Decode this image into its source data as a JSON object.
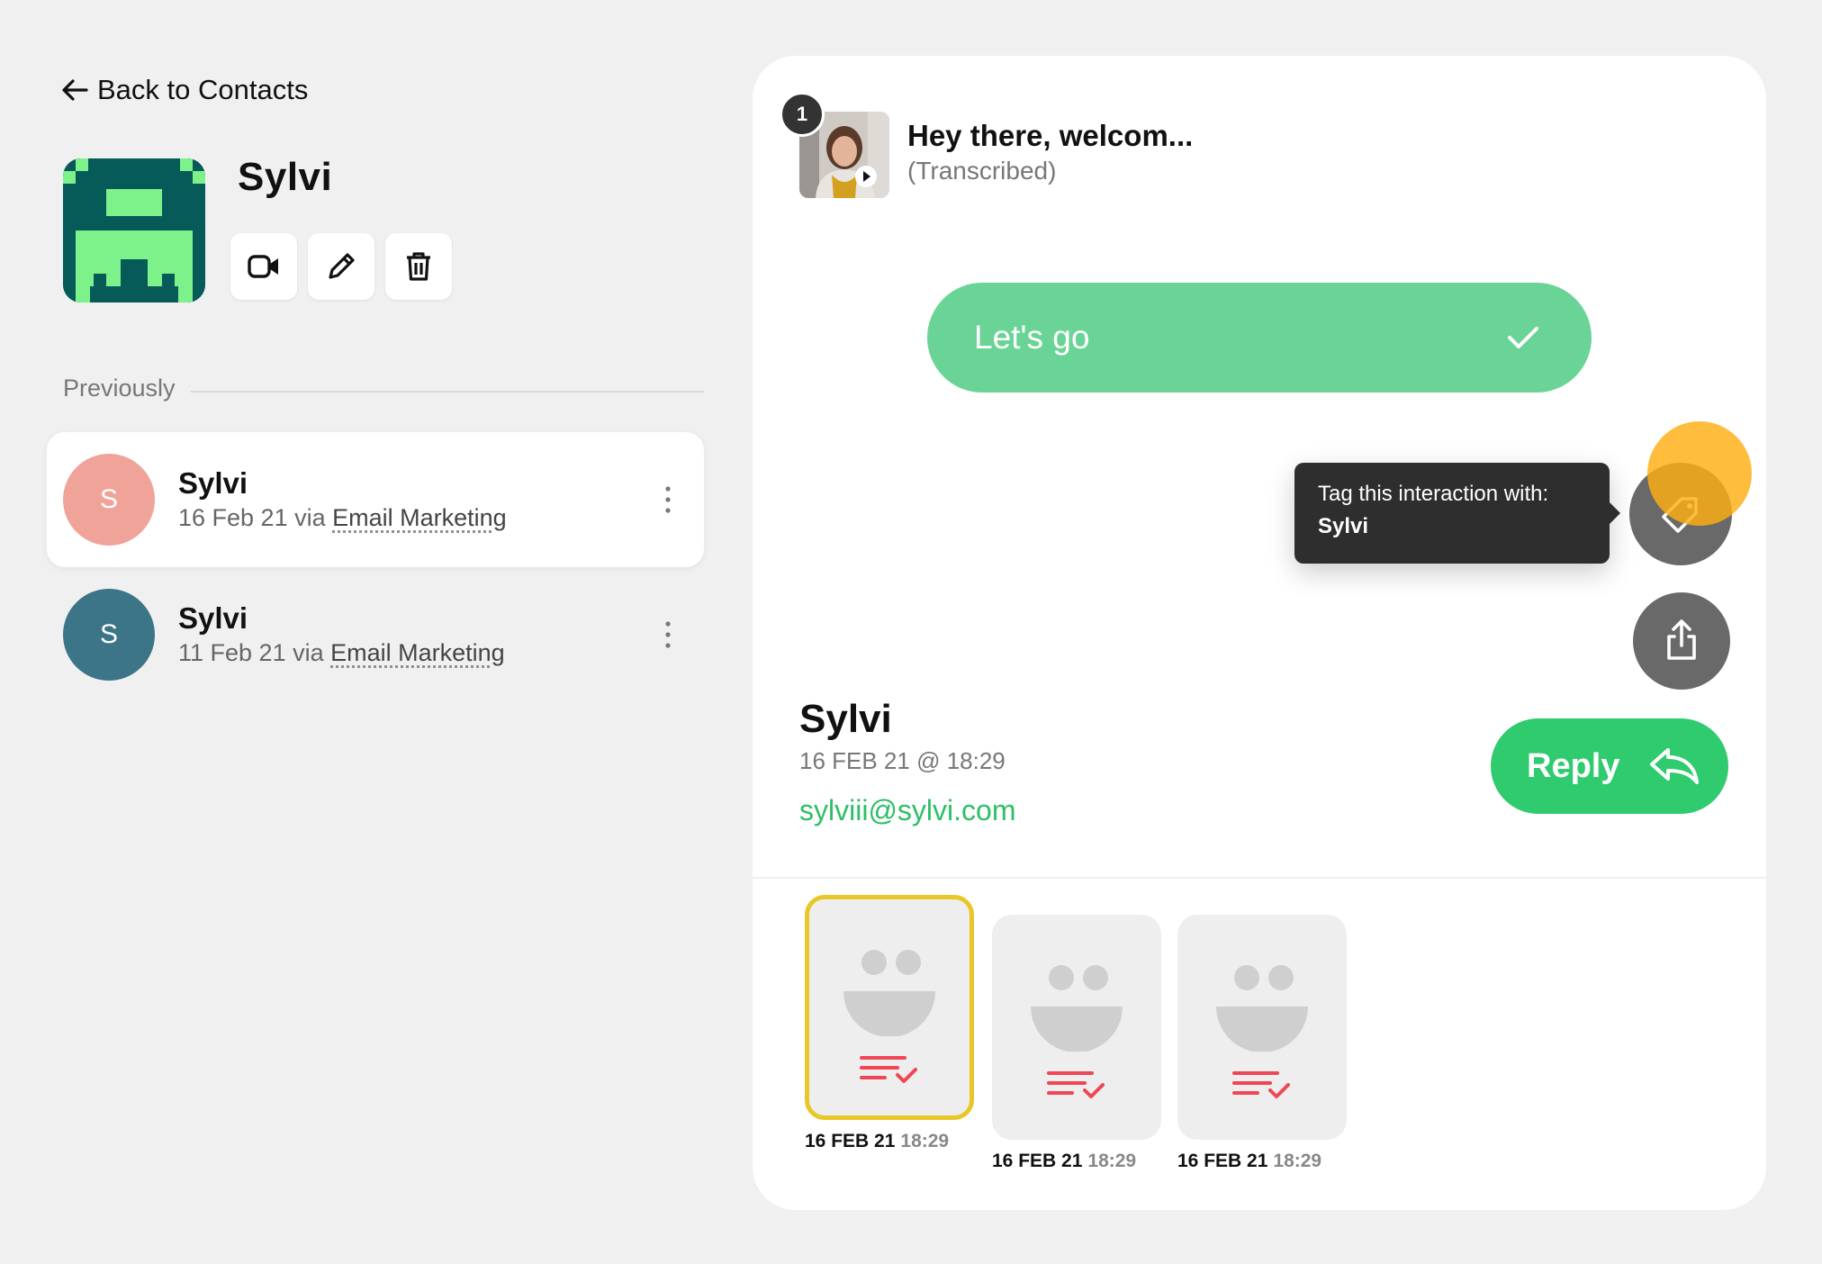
{
  "nav": {
    "back_label": "Back to Contacts"
  },
  "contact": {
    "name": "Sylvi",
    "actions": [
      "video",
      "edit",
      "delete"
    ]
  },
  "previously": {
    "label": "Previously",
    "items": [
      {
        "initial": "S",
        "name": "Sylvi",
        "date": "16 Feb 21 via ",
        "source": "Email Marketing",
        "avatar_color": "#f0a399",
        "active": true
      },
      {
        "initial": "S",
        "name": "Sylvi",
        "date": "11 Feb 21 via ",
        "source": "Email Marketing",
        "avatar_color": "#3b7587",
        "active": false
      }
    ]
  },
  "conversation": {
    "step_number": "1",
    "video_title": "Hey there, welcom...",
    "video_subtitle": "(Transcribed)",
    "answer_text": "Let's go",
    "tooltip": {
      "line1": "Tag this interaction with:",
      "line2": "Sylvi"
    },
    "respondent": {
      "name": "Sylvi",
      "datetime": "16 FEB 21 @ 18:29",
      "email": "sylviii@sylvi.com"
    },
    "reply_label": "Reply",
    "responses": [
      {
        "date": "16 FEB 21",
        "time": "18:29",
        "selected": true
      },
      {
        "date": "16 FEB 21",
        "time": "18:29",
        "selected": false
      },
      {
        "date": "16 FEB 21",
        "time": "18:29",
        "selected": false
      }
    ]
  },
  "colors": {
    "brand_green": "#2fcb6e",
    "answer_green": "#6ad497",
    "highlight": "#ffaf14",
    "tile_selected_border": "#e9c728",
    "list_icon_red": "#f04656"
  }
}
